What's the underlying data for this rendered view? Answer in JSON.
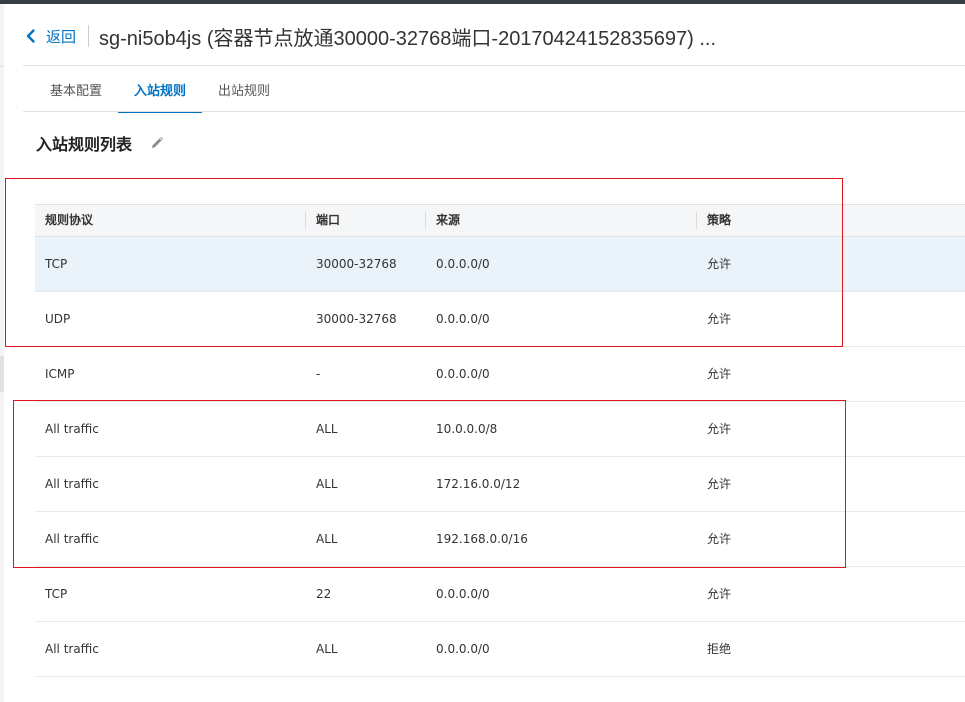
{
  "header": {
    "back_label": "返回",
    "title": "sg-ni5ob4js (容器节点放通30000-32768端口-20170424152835697) ..."
  },
  "tabs": [
    {
      "label": "基本配置",
      "active": false
    },
    {
      "label": "入站规则",
      "active": true
    },
    {
      "label": "出站规则",
      "active": false
    }
  ],
  "section": {
    "title": "入站规则列表",
    "edit_icon": "pencil-icon"
  },
  "table": {
    "columns": [
      "规则协议",
      "端口",
      "来源",
      "策略"
    ],
    "rows": [
      {
        "protocol": "TCP",
        "port": "30000-32768",
        "source": "0.0.0.0/0",
        "policy": "允许"
      },
      {
        "protocol": "UDP",
        "port": "30000-32768",
        "source": "0.0.0.0/0",
        "policy": "允许"
      },
      {
        "protocol": "ICMP",
        "port": "-",
        "source": "0.0.0.0/0",
        "policy": "允许"
      },
      {
        "protocol": "All traffic",
        "port": "ALL",
        "source": "10.0.0.0/8",
        "policy": "允许"
      },
      {
        "protocol": "All traffic",
        "port": "ALL",
        "source": "172.16.0.0/12",
        "policy": "允许"
      },
      {
        "protocol": "All traffic",
        "port": "ALL",
        "source": "192.168.0.0/16",
        "policy": "允许"
      },
      {
        "protocol": "TCP",
        "port": "22",
        "source": "0.0.0.0/0",
        "policy": "允许"
      },
      {
        "protocol": "All traffic",
        "port": "ALL",
        "source": "0.0.0.0/0",
        "policy": "拒绝"
      }
    ]
  },
  "colors": {
    "accent": "#0073c6",
    "highlight_row": "#eaf2fa",
    "annotation_box": "#e0141c"
  }
}
